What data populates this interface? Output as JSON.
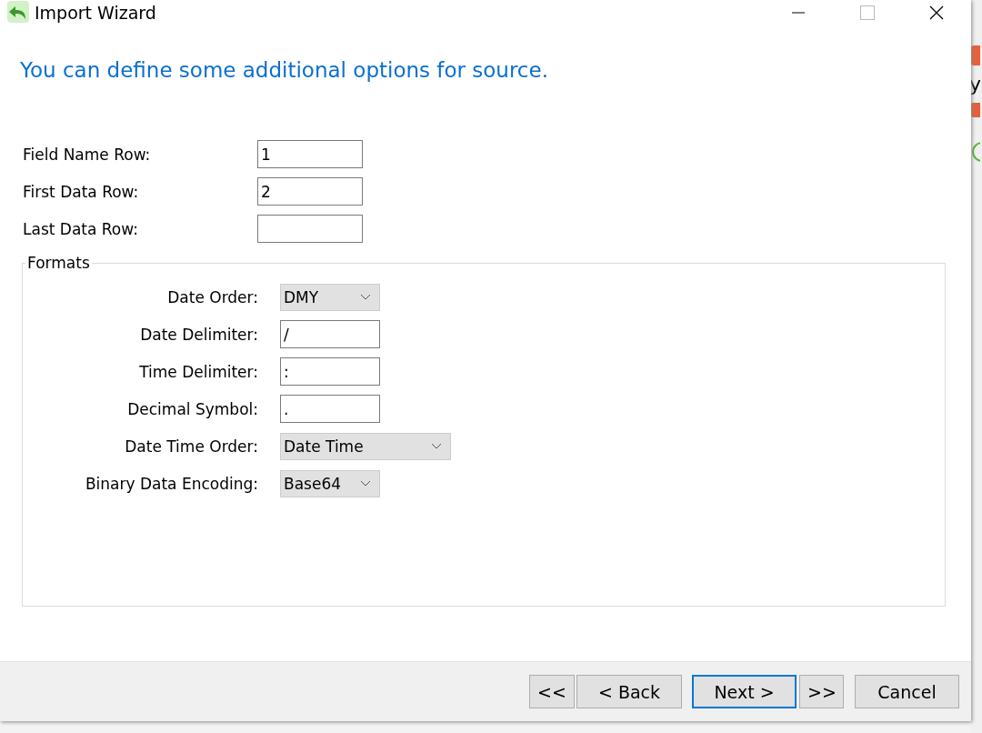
{
  "window": {
    "title": "Import Wizard"
  },
  "heading": "You can define some additional options for source.",
  "fields": [
    {
      "label": "Field Name Row:",
      "value": "1"
    },
    {
      "label": "First Data Row:",
      "value": "2"
    },
    {
      "label": "Last Data Row:"
    }
  ],
  "formats": {
    "title": "Formats",
    "rows": [
      {
        "kind": "dropdown",
        "label": "Date Order:",
        "value": "DMY",
        "wide": false
      },
      {
        "kind": "text",
        "label": "Date Delimiter:",
        "value": "/"
      },
      {
        "kind": "text",
        "label": "Time Delimiter:",
        "value": ":"
      },
      {
        "kind": "text",
        "label": "Decimal Symbol:",
        "value": "."
      },
      {
        "kind": "dropdown",
        "label": "Date Time Order:",
        "value": "Date Time",
        "wide": true
      },
      {
        "kind": "dropdown",
        "label": "Binary Data Encoding:",
        "value": "Base64",
        "wide": false
      }
    ]
  },
  "buttons": [
    {
      "label": "<<",
      "focused": false
    },
    {
      "label": "< Back",
      "focused": false
    },
    {
      "label": "Next >",
      "focused": true
    },
    {
      "label": ">>",
      "focused": false
    },
    {
      "label": "Cancel",
      "focused": false
    }
  ],
  "background_window": {
    "text": "y"
  }
}
